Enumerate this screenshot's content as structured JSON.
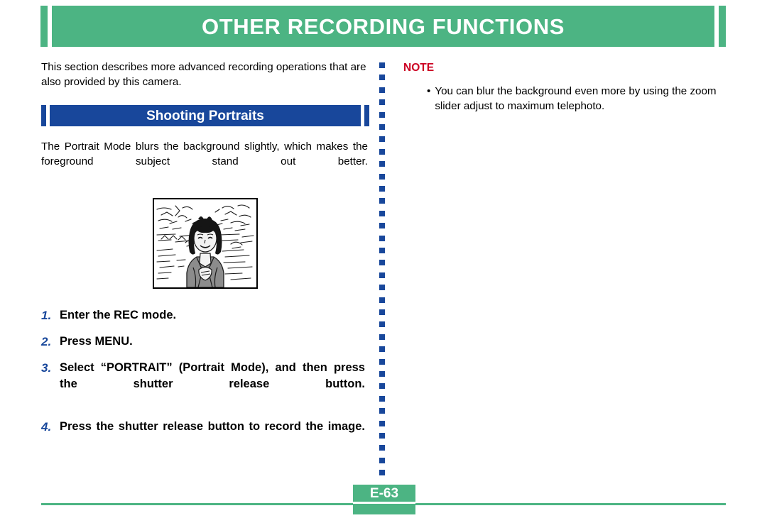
{
  "header": {
    "title": "OTHER RECORDING FUNCTIONS",
    "background_color": "#4cb483",
    "text_color": "#ffffff"
  },
  "left_column": {
    "intro_paragraph": "This section describes more advanced recording operations that are also provided by this camera.",
    "section": {
      "title": "Shooting Portraits",
      "background_color": "#18479b",
      "text_color": "#ffffff"
    },
    "portrait_paragraph": "The Portrait Mode blurs the background slightly, which makes the foreground subject stand out better.",
    "illustration_caption": "Line drawing of a smiling woman in a gray jacket standing in front of a blurred outdoor landscape",
    "steps": [
      {
        "number": "1.",
        "text": "Enter the REC mode."
      },
      {
        "number": "2.",
        "text": "Press MENU."
      },
      {
        "number": "3.",
        "text": "Select “PORTRAIT” (Portrait Mode), and then press the shutter release button."
      },
      {
        "number": "4.",
        "text": "Press the shutter release button to record the image."
      }
    ],
    "step_number_color": "#18479b"
  },
  "right_column": {
    "note_label": "NOTE",
    "note_label_color": "#cc0022",
    "notes": [
      {
        "bullet": "•",
        "text": "You can blur the background even more by using the zoom slider adjust to maximum telephoto."
      }
    ]
  },
  "divider": {
    "square_color": "#18479b",
    "square_count": 34
  },
  "footer": {
    "page_number": "E-63",
    "rule_color": "#4cb483",
    "badge_color": "#4cb483"
  }
}
